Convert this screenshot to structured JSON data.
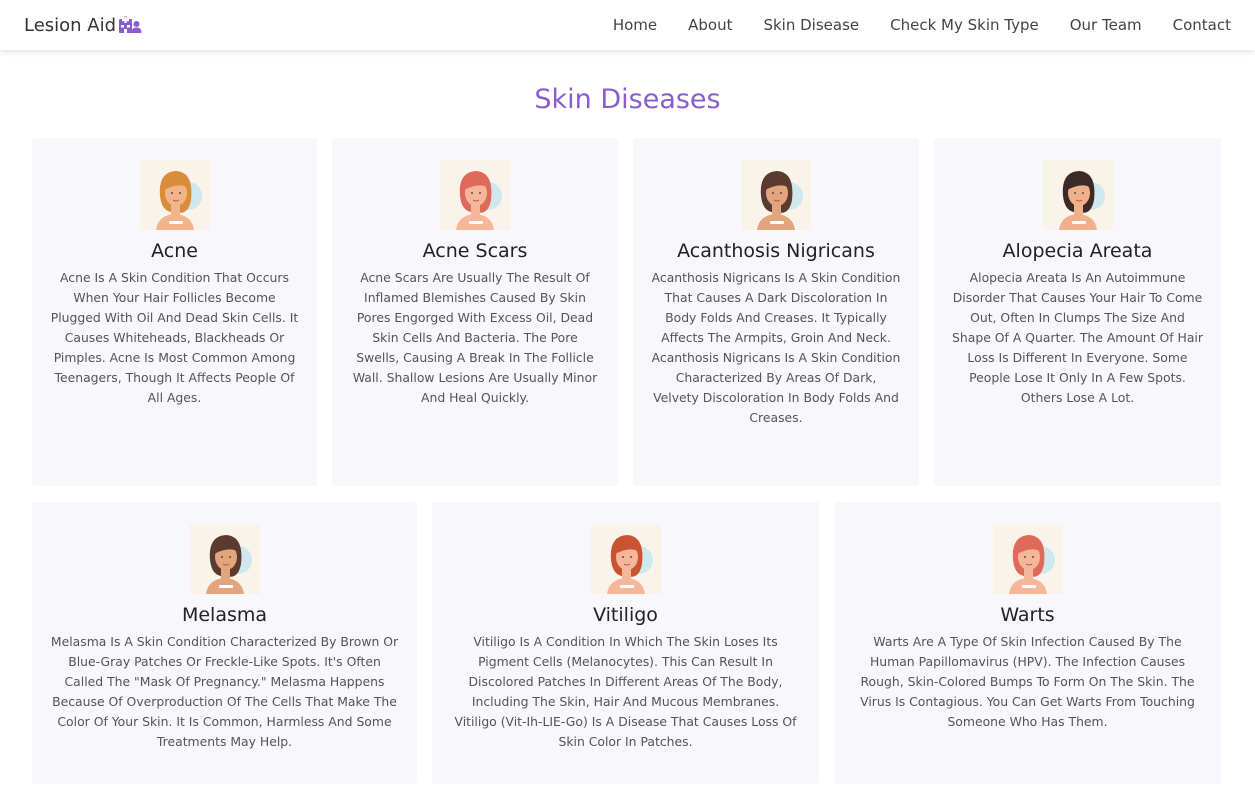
{
  "brand": {
    "name": "Lesion Aid",
    "icon": "hospital-user-icon",
    "accent": "#8a5cd0"
  },
  "nav": [
    "Home",
    "About",
    "Skin Disease",
    "Check My Skin Type",
    "Our Team",
    "Contact"
  ],
  "page_title": "Skin Diseases",
  "cards": [
    {
      "title": "Acne",
      "text": "Acne Is A Skin Condition That Occurs When Your Hair Follicles Become Plugged With Oil And Dead Skin Cells. It Causes Whiteheads, Blackheads Or Pimples. Acne Is Most Common Among Teenagers, Though It Affects People Of All Ages.",
      "avatar": {
        "hair": "#d98c3a",
        "skin": "#f2b48a",
        "bg": "#cfe8ee"
      }
    },
    {
      "title": "Acne Scars",
      "text": "Acne Scars Are Usually The Result Of Inflamed Blemishes Caused By Skin Pores Engorged With Excess Oil, Dead Skin Cells And Bacteria. The Pore Swells, Causing A Break In The Follicle Wall. Shallow Lesions Are Usually Minor And Heal Quickly.",
      "avatar": {
        "hair": "#e06a5a",
        "skin": "#f4b79a",
        "bg": "#cfe8ee"
      }
    },
    {
      "title": "Acanthosis Nigricans",
      "text": "Acanthosis Nigricans Is A Skin Condition That Causes A Dark Discoloration In Body Folds And Creases. It Typically Affects The Armpits, Groin And Neck. Acanthosis Nigricans Is A Skin Condition Characterized By Areas Of Dark, Velvety Discoloration In Body Folds And Creases.",
      "avatar": {
        "hair": "#5a3b30",
        "skin": "#e3a57e",
        "bg": "#cfe8ee"
      }
    },
    {
      "title": "Alopecia Areata",
      "text": "Alopecia Areata Is An Autoimmune Disorder That Causes Your Hair To Come Out, Often In Clumps The Size And Shape Of A Quarter. The Amount Of Hair Loss Is Different In Everyone. Some People Lose It Only In A Few Spots. Others Lose A Lot.",
      "avatar": {
        "hair": "#3b2a25",
        "skin": "#f0b08c",
        "bg": "#cfe8ee"
      }
    },
    {
      "title": "Melasma",
      "text": "Melasma Is A Skin Condition Characterized By Brown Or Blue-Gray Patches Or Freckle-Like Spots. It's Often Called The \"Mask Of Pregnancy.\" Melasma Happens Because Of Overproduction Of The Cells That Make The Color Of Your Skin. It Is Common, Harmless And Some Treatments May Help.",
      "avatar": {
        "hair": "#5a3b30",
        "skin": "#e3a57e",
        "bg": "#cfe8ee"
      }
    },
    {
      "title": "Vitiligo",
      "text": "Vitiligo Is A Condition In Which The Skin Loses Its Pigment Cells (Melanocytes). This Can Result In Discolored Patches In Different Areas Of The Body, Including The Skin, Hair And Mucous Membranes. Vitiligo (Vit-Ih-LIE-Go) Is A Disease That Causes Loss Of Skin Color In Patches.",
      "avatar": {
        "hair": "#c9542f",
        "skin": "#f4b79a",
        "bg": "#cfe8ee"
      }
    },
    {
      "title": "Warts",
      "text": "Warts Are A Type Of Skin Infection Caused By The Human Papillomavirus (HPV). The Infection Causes Rough, Skin-Colored Bumps To Form On The Skin. The Virus Is Contagious. You Can Get Warts From Touching Someone Who Has Them.",
      "avatar": {
        "hair": "#e06a5a",
        "skin": "#f4b79a",
        "bg": "#cfe8ee"
      }
    }
  ]
}
